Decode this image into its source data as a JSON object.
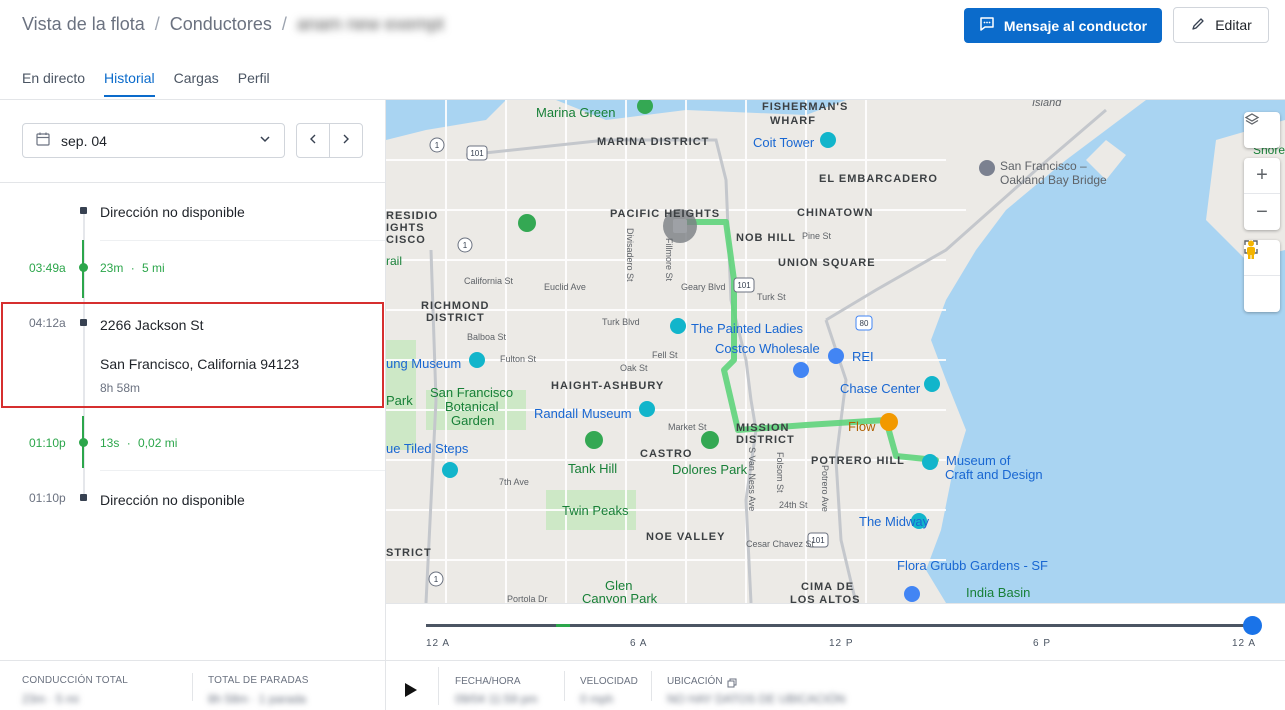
{
  "breadcrumb": {
    "root": "Vista de la flota",
    "section": "Conductores",
    "current": "anam new exempt"
  },
  "actions": {
    "message_label": "Mensaje al conductor",
    "edit_label": "Editar"
  },
  "tabs": [
    {
      "label": "En directo",
      "active": false
    },
    {
      "label": "Historial",
      "active": true
    },
    {
      "label": "Cargas",
      "active": false
    },
    {
      "label": "Perfil",
      "active": false
    }
  ],
  "date_picker": {
    "value": "sep. 04"
  },
  "timeline": {
    "items": [
      {
        "time": "",
        "text": "Dirección no disponible"
      },
      {
        "time": "03:49a",
        "drive": "23m",
        "distance": "5 mi"
      },
      {
        "time": "04:12a",
        "address_line1": "2266 Jackson St",
        "address_line2": "San Francisco, California 94123",
        "duration": "8h 58m"
      },
      {
        "time": "01:10p",
        "drive": "13s",
        "distance": "0,02 mi"
      },
      {
        "time": "01:10p",
        "text": "Dirección no disponible"
      }
    ],
    "separator": "·"
  },
  "summary": {
    "total_driving_label": "CONDUCCIÓN TOTAL",
    "total_driving_value": "23m · 5 mi",
    "total_stops_label": "TOTAL DE PARADAS",
    "total_stops_value": "8h 58m · 1 parada"
  },
  "map": {
    "labels": {
      "marina_green": "Marina Green",
      "fishermans": "FISHERMAN'S",
      "wharf": "WHARF",
      "island": "Island",
      "marina_district": "MARINA DISTRICT",
      "coit_tower": "Coit Tower",
      "el_embarcadero": "EL EMBARCADERO",
      "bay_bridge_1": "San Francisco –",
      "bay_bridge_2": "Oakland Bay Bridge",
      "shore": "Shore",
      "pacific_heights": "PACIFIC HEIGHTS",
      "chinatown": "CHINATOWN",
      "nob_hill": "NOB HILL",
      "pine_st": "Pine St",
      "presidio_1": "RESIDIO",
      "presidio_2": "IGHTS",
      "presidio_3": "CISCO",
      "divisadero": "Divisadero St",
      "fillmore": "Fillmore St",
      "union_square": "UNION SQUARE",
      "rail": "rail",
      "california_st": "California St",
      "euclid": "Euclid Ave",
      "geary": "Geary Blvd",
      "turk": "Turk St",
      "richmond_1": "RICHMOND",
      "richmond_2": "DISTRICT",
      "turk_blvd": "Turk Blvd",
      "painted_ladies": "The Painted Ladies",
      "balboa": "Balboa St",
      "fell": "Fell St",
      "costco": "Costco Wholesale",
      "rei": "REI",
      "museum": "ung Museum",
      "fulton": "Fulton St",
      "oak": "Oak St",
      "haight": "HAIGHT-ASHBURY",
      "chase_center": "Chase Center",
      "sf_botanical_1": "San Francisco",
      "sf_botanical_2": "Botanical",
      "sf_botanical_3": "Garden",
      "park": "Park",
      "randall": "Randall Museum",
      "mission_1": "MISSION",
      "mission_2": "DISTRICT",
      "flow": "Flow",
      "market": "Market St",
      "castro": "CASTRO",
      "potrero": "POTRERO HILL",
      "museum_craft_1": "Museum of",
      "museum_craft_2": "Craft and Design",
      "tiled_steps": "ue Tiled Steps",
      "tank_hill": "Tank Hill",
      "dolores_park": "Dolores Park",
      "seventh_ave": "7th Ave",
      "twin_peaks": "Twin Peaks",
      "folsom": "Folsom St",
      "van_ness": "S Van Ness Ave",
      "potrero_ave": "Potrero Ave",
      "24th": "24th St",
      "midway": "The Midway",
      "noe_valley": "NOE VALLEY",
      "cesar_chavez": "Cesar Chavez St",
      "strict": "STRICT",
      "flora_grubb": "Flora Grubb Gardens - SF",
      "glen_1": "Glen",
      "glen_2": "Canyon Park",
      "cima_1": "CIMA DE",
      "cima_2": "LOS ALTOS",
      "india_basin": "India Basin",
      "portola": "Portola Dr",
      "shield_101": "101",
      "shield_1": "1",
      "shield_80": "80"
    },
    "route_color": "#5fd47b"
  },
  "scrubber": {
    "ticks": [
      "12 A",
      "6 A",
      "12 P",
      "6 P",
      "12 A"
    ],
    "position": 1.0
  },
  "details": {
    "datetime_label": "FECHA/HORA",
    "datetime_value": "09/04 11:59 pm",
    "speed_label": "VELOCIDAD",
    "speed_value": "0 mph",
    "location_label": "UBICACIÓN",
    "location_value": "NO HAY DATOS DE UBICACIÓN"
  }
}
